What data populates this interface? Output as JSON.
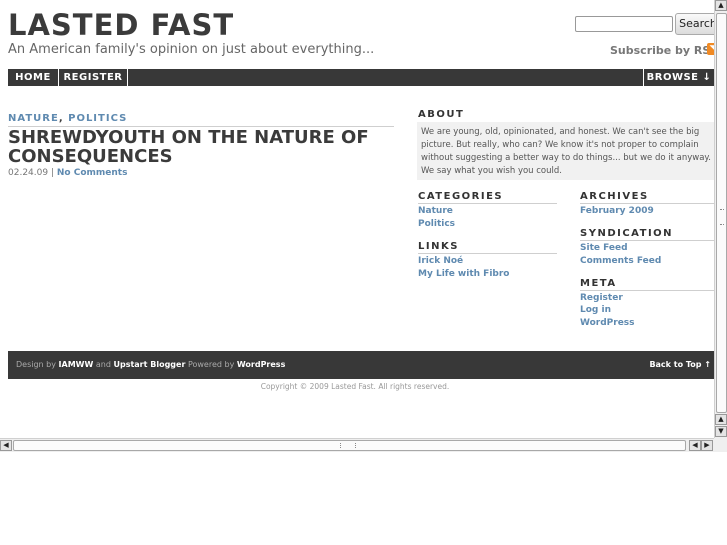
{
  "header": {
    "site_title": "LASTED FAST",
    "tagline": "An American family's opinion on just about everything...",
    "search_placeholder": "",
    "search_button": "Search",
    "subscribe_label": "Subscribe by RSS",
    "rss_glyph": "◥"
  },
  "nav": {
    "home": "HOME",
    "register": "REGISTER",
    "browse": "BROWSE ↓"
  },
  "post": {
    "categories": [
      "NATURE",
      "POLITICS"
    ],
    "category_separator": ",",
    "title": "SHREWDYOUTH ON THE NATURE OF CONSEQUENCES",
    "date": "02.24.09",
    "meta_separator": "|",
    "comments": "No Comments"
  },
  "sidebar": {
    "about": {
      "title": "ABOUT",
      "text": "We are young, old, opinionated, and honest. We can't see the big picture. But really, who can? We know it's not proper to complain without suggesting a better way to do things... but we do it anyway. We say what you wish you could."
    },
    "categories": {
      "title": "CATEGORIES",
      "items": [
        "Nature",
        "Politics"
      ]
    },
    "links": {
      "title": "LINKS",
      "items": [
        "Irick Noé",
        "My Life with Fibro"
      ]
    },
    "archives": {
      "title": "ARCHIVES",
      "items": [
        "February 2009"
      ]
    },
    "syndication": {
      "title": "SYNDICATION",
      "items": [
        "Site Feed",
        "Comments Feed"
      ]
    },
    "meta": {
      "title": "META",
      "items": [
        "Register",
        "Log in",
        "WordPress"
      ]
    }
  },
  "footer": {
    "design_by": "Design by",
    "designer1": "IAMWW",
    "and": "and",
    "designer2": "Upstart Blogger",
    "powered_by": "Powered by",
    "platform": "WordPress",
    "back_to_top": "Back to Top ↑",
    "copyright": "Copyright © 2009 Lasted Fast. All rights reserved."
  },
  "scrollbars": {
    "up_arrow": "▲",
    "down_arrow": "▼",
    "left_arrow": "◀",
    "right_arrow": "▶"
  },
  "colors": {
    "link": "#5f8ab0",
    "nav_bg": "#383838",
    "rss": "#f08a24"
  }
}
